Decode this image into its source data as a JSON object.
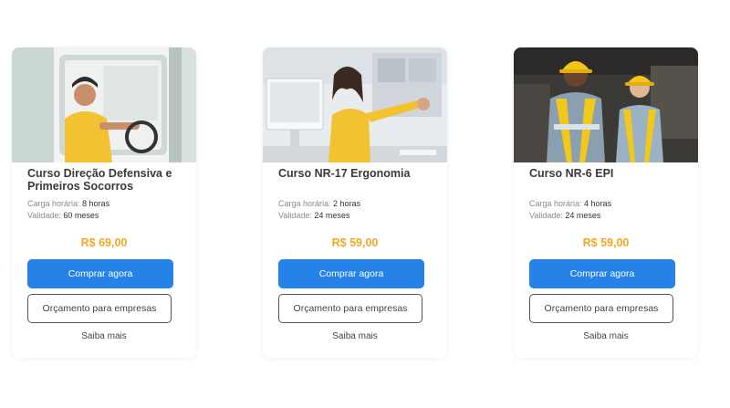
{
  "courses": [
    {
      "title": "Curso Direção Defensiva e Primeiros Socorros",
      "workload_label": "Carga horária:",
      "workload_value": "8 horas",
      "validity_label": "Validade:",
      "validity_value": "60 meses",
      "price": "R$ 69,00",
      "buy_label": "Comprar agora",
      "quote_label": "Orçamento para empresas",
      "more_label": "Saiba mais"
    },
    {
      "title": "Curso NR-17 Ergonomia",
      "workload_label": "Carga horária:",
      "workload_value": "2 horas",
      "validity_label": "Validade:",
      "validity_value": "24 meses",
      "price": "R$ 59,00",
      "buy_label": "Comprar agora",
      "quote_label": "Orçamento para empresas",
      "more_label": "Saiba mais"
    },
    {
      "title": "Curso NR-6 EPI",
      "workload_label": "Carga horária:",
      "workload_value": "4 horas",
      "validity_label": "Validade:",
      "validity_value": "24 meses",
      "price": "R$ 59,00",
      "buy_label": "Comprar agora",
      "quote_label": "Orçamento para empresas",
      "more_label": "Saiba mais"
    }
  ],
  "colors": {
    "primary_button": "#2583e8",
    "price": "#f5a623"
  }
}
